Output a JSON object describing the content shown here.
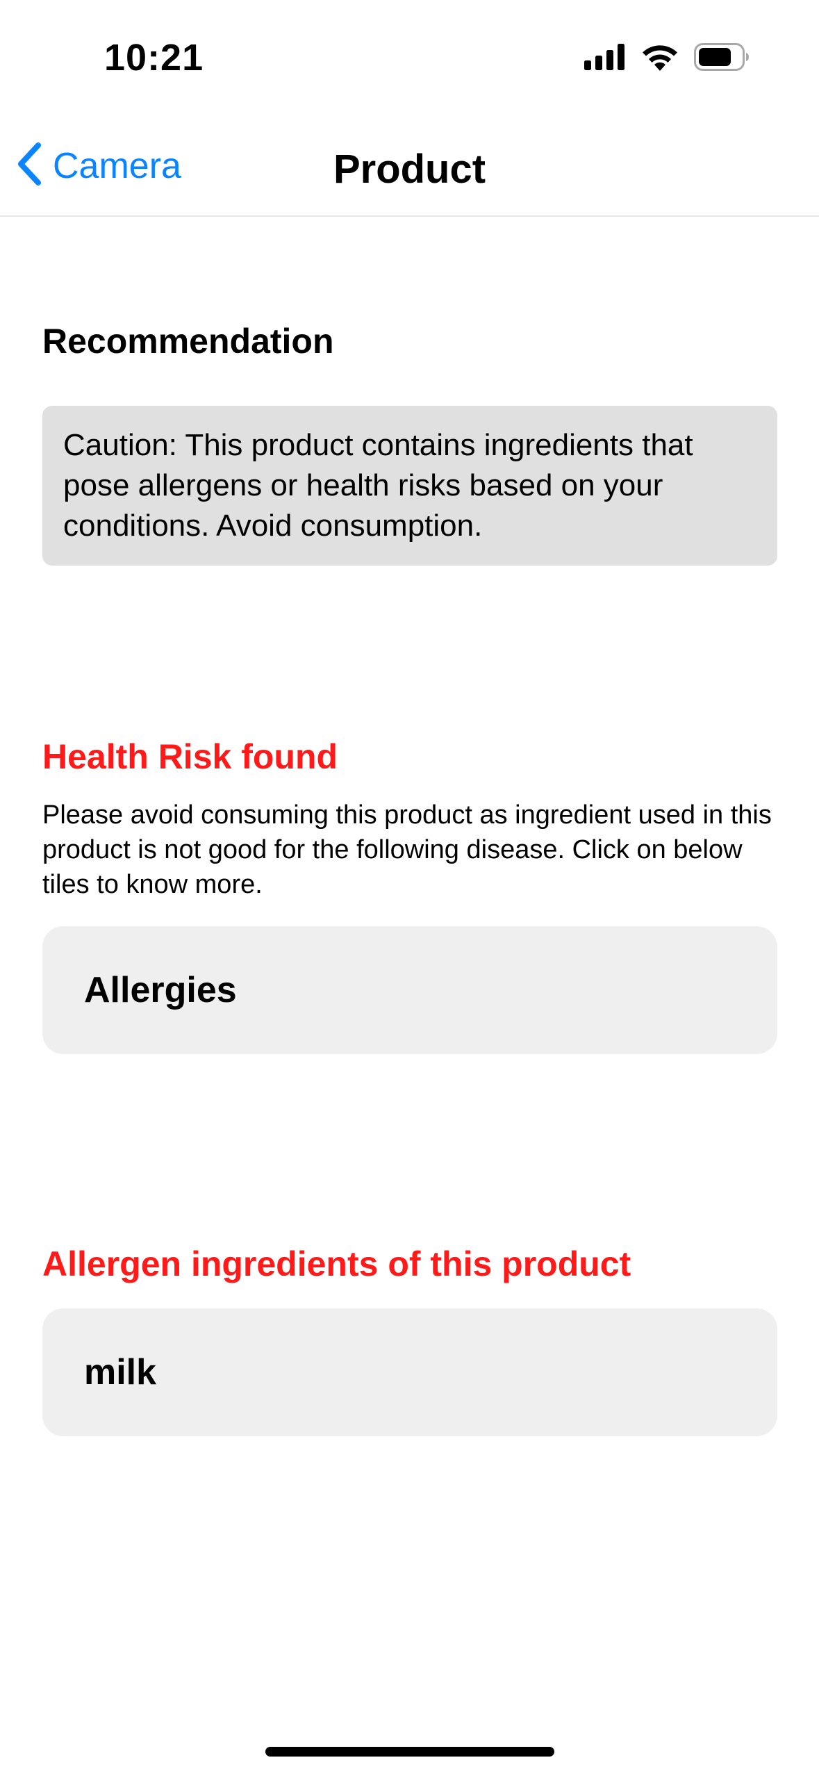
{
  "status_bar": {
    "time": "10:21",
    "icons": [
      "cellular-signal-icon",
      "wifi-icon",
      "battery-icon"
    ]
  },
  "nav": {
    "back_label": "Camera",
    "title": "Product",
    "accent_color": "#0a84ff"
  },
  "recommendation": {
    "heading": "Recommendation",
    "message": "Caution: This product contains ingredients that pose allergens or health risks based on your conditions. Avoid consumption."
  },
  "health_risk": {
    "heading": "Health Risk found",
    "heading_color": "#ff1a1a",
    "description": "Please avoid consuming this product as ingredient used in this product is not good for the following disease. Click on below tiles to know more.",
    "tiles": [
      "Allergies"
    ]
  },
  "allergens": {
    "heading": "Allergen ingredients of this product",
    "heading_color": "#ff1a1a",
    "items": [
      "milk"
    ]
  }
}
